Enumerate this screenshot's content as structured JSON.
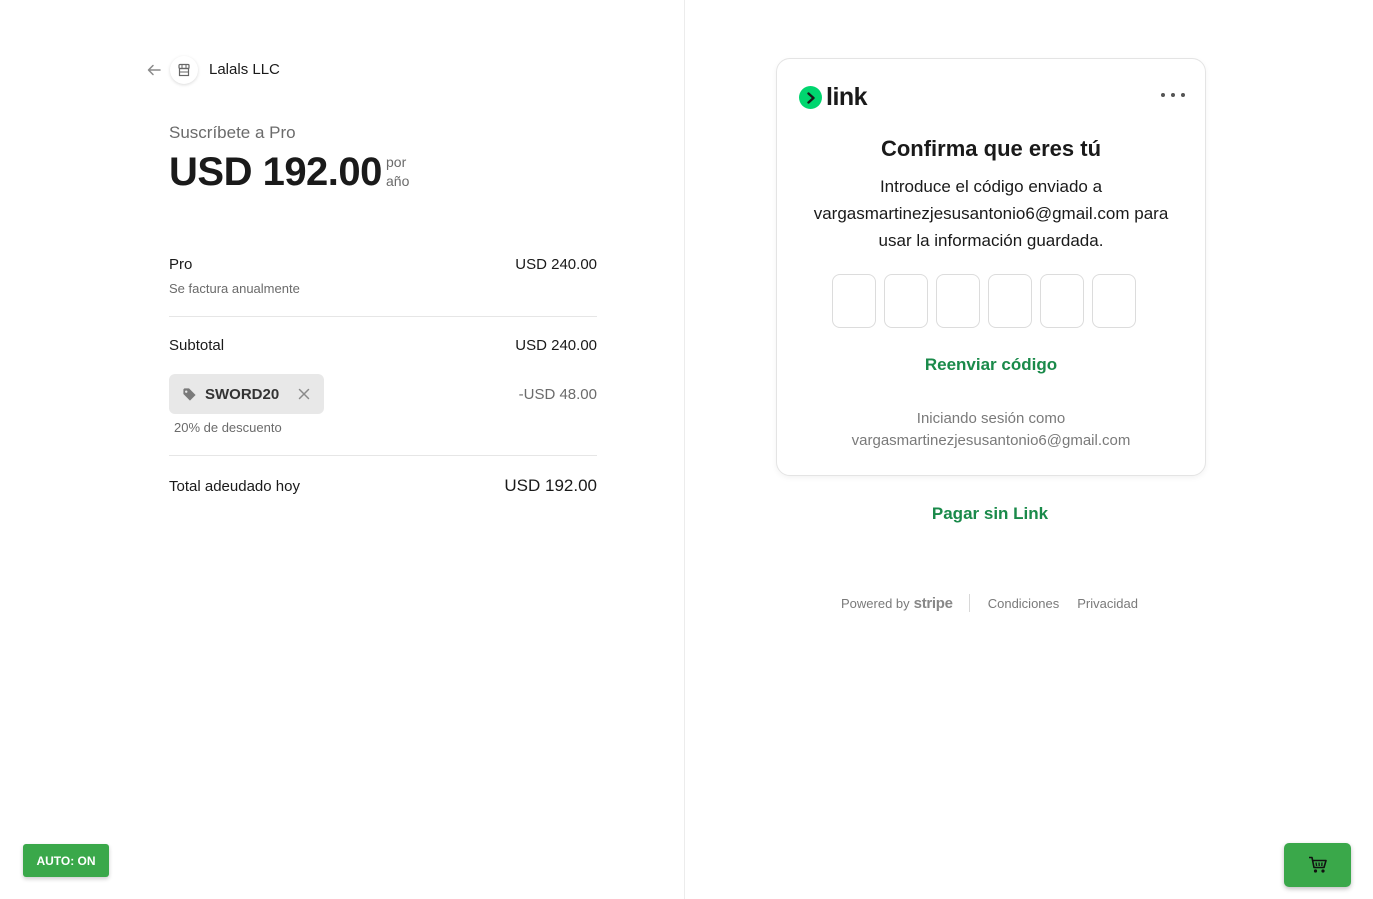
{
  "merchant": {
    "name": "Lalals LLC"
  },
  "summary": {
    "subscribe_label": "Suscríbete a Pro",
    "price": "USD 192.00",
    "per_line1": "por",
    "per_line2": "año"
  },
  "line_items": {
    "product_name": "Pro",
    "product_note": "Se factura anualmente",
    "product_amount": "USD 240.00",
    "subtotal_label": "Subtotal",
    "subtotal_amount": "USD 240.00",
    "coupon_code": "SWORD20",
    "coupon_note": "20% de descuento",
    "discount_amount": "-USD 48.00",
    "total_label": "Total adeudado hoy",
    "total_amount": "USD 192.00"
  },
  "link_card": {
    "logo_text": "link",
    "title": "Confirma que eres tú",
    "description": "Introduce el código enviado a vargasmartinezjesusantonio6@gmail.com para usar la información guardada.",
    "resend_label": "Reenviar código",
    "signed_in_label": "Iniciando sesión como",
    "signed_in_email": "vargasmartinezjesusantonio6@gmail.com"
  },
  "pay_without_link": "Pagar sin Link",
  "footer": {
    "powered_by": "Powered by",
    "stripe": "stripe",
    "terms": "Condiciones",
    "privacy": "Privacidad"
  },
  "overlay": {
    "auto_label": "AUTO: ON"
  },
  "colors": {
    "link_green": "#00d66f",
    "action_green": "#1a8a4a",
    "button_green": "#3aa84a"
  }
}
